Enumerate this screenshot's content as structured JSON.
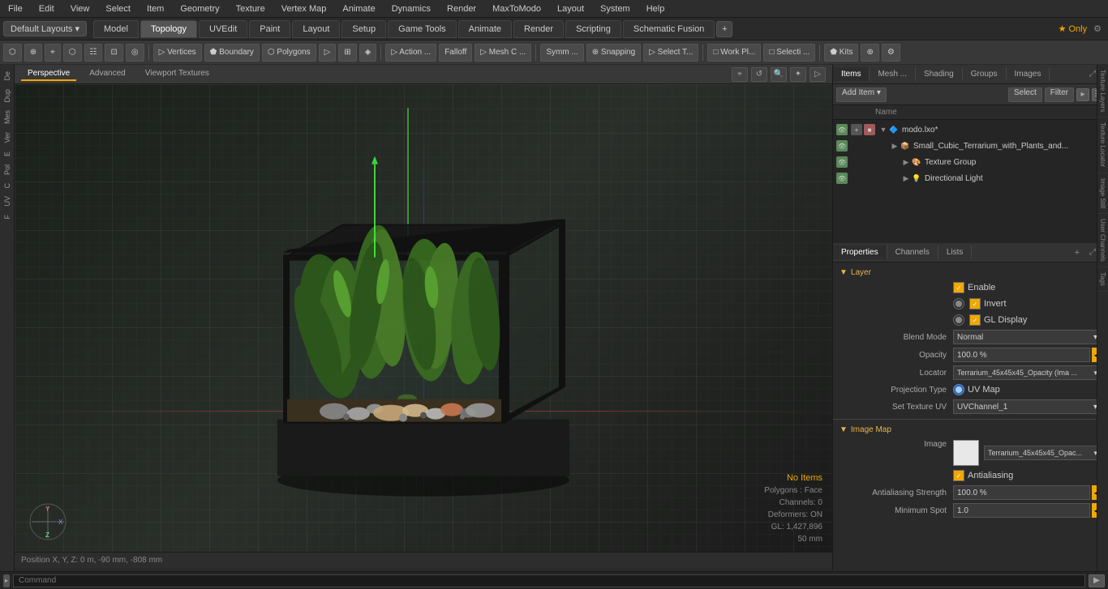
{
  "menubar": {
    "items": [
      "File",
      "Edit",
      "View",
      "Select",
      "Item",
      "Geometry",
      "Texture",
      "Vertex Map",
      "Animate",
      "Dynamics",
      "Render",
      "MaxToModo",
      "Layout",
      "System",
      "Help"
    ]
  },
  "layout": {
    "dropdown": "Default Layouts ▾",
    "tabs": [
      "Model",
      "Topology",
      "UVEdit",
      "Paint",
      "Layout",
      "Setup",
      "Game Tools",
      "Animate",
      "Render",
      "Scripting",
      "Schematic Fusion"
    ],
    "plus": "+",
    "star_only": "★ Only"
  },
  "toolbar": {
    "items": [
      "⬡",
      "⊕",
      "⌖",
      "⬡",
      "☷",
      "⊡",
      "◎",
      "▷ Vertices",
      "Boundary",
      "Polygons",
      "▷",
      "⊞",
      "◈",
      "▷ Action ...",
      "Falloff",
      "▷ Mesh C ...",
      "Symm ...",
      "Snapping",
      "▷ Select T...",
      "Work Pl...",
      "Selecti ...",
      "Kits"
    ]
  },
  "viewport": {
    "tabs": [
      "Perspective",
      "Advanced",
      "Viewport Textures"
    ],
    "info": {
      "no_items": "No Items",
      "polygons": "Polygons : Face",
      "channels": "Channels: 0",
      "deformers": "Deformers: ON",
      "gl": "GL: 1,427,896",
      "mm": "50 mm"
    },
    "status": "Position X, Y, Z:  0 m, -90 mm, -808 mm"
  },
  "items_panel": {
    "tabs": [
      "Items",
      "Mesh ...",
      "Shading",
      "Groups",
      "Images"
    ],
    "toolbar": {
      "add_item": "Add Item",
      "dropdown_arrow": "▾",
      "select": "Select",
      "filter": "Filter"
    },
    "col_header": "Name",
    "tree": [
      {
        "level": 0,
        "expand": true,
        "icon": "🔷",
        "label": "modo.lxo*",
        "eye": true
      },
      {
        "level": 1,
        "expand": false,
        "icon": "📦",
        "label": "Small_Cubic_Terrarium_with_Plants_and...",
        "eye": true
      },
      {
        "level": 2,
        "expand": false,
        "icon": "🎨",
        "label": "Texture Group",
        "eye": true
      },
      {
        "level": 2,
        "expand": false,
        "icon": "💡",
        "label": "Directional Light",
        "eye": true
      }
    ]
  },
  "properties": {
    "tabs": [
      "Properties",
      "Channels",
      "Lists"
    ],
    "layer": {
      "header": "Layer",
      "enable": {
        "label": "Enable",
        "checked": true
      },
      "invert": {
        "label": "Invert",
        "checked": false
      },
      "gl_display": {
        "label": "GL Display",
        "checked": true
      }
    },
    "blend_mode": {
      "label": "Blend Mode",
      "value": "Normal"
    },
    "opacity": {
      "label": "Opacity",
      "value": "100.0 %"
    },
    "locator": {
      "label": "Locator",
      "value": "Terrarium_45x45x45_Opacity (Ima ..."
    },
    "projection_type": {
      "label": "Projection Type",
      "value": "UV Map"
    },
    "set_texture_uv": {
      "label": "Set Texture UV",
      "value": "UVChannel_1"
    },
    "image_map": {
      "header": "Image Map",
      "image_label": "Image",
      "image_value": "Terrarium_45x45x45_Opac..."
    },
    "antialiasing": {
      "label": "Antialiasing",
      "checked": true
    },
    "antialiasing_strength": {
      "label": "Antialiasing Strength",
      "value": "100.0 %"
    },
    "minimum_spot": {
      "label": "Minimum Spot",
      "value": "1.0"
    }
  },
  "vtabs": [
    "Texture Layers",
    "Texture Locator",
    "Image Still",
    "User Channels",
    "Tags"
  ],
  "command": {
    "placeholder": "Command"
  },
  "colors": {
    "accent": "#f0a800",
    "active_tab_bg": "#555",
    "panel_bg": "#2d2d2d",
    "input_bg": "#3a3a3a"
  }
}
